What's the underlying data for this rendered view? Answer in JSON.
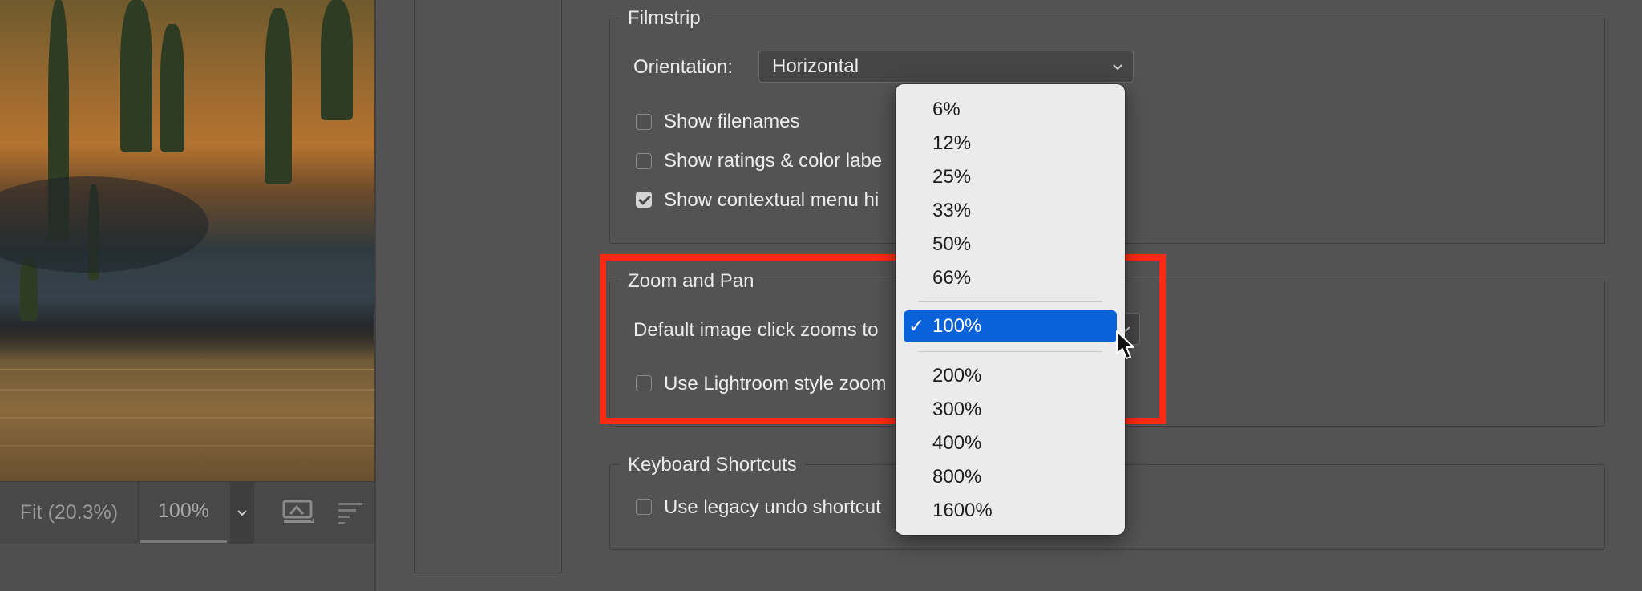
{
  "photo": {
    "description_name": "landscape-preview"
  },
  "zoombar": {
    "fit_label": "Fit (20.3%)",
    "zoom_value": "100%"
  },
  "filmstrip": {
    "title": "Filmstrip",
    "orientation_label": "Orientation:",
    "orientation_value": "Horizontal",
    "show_filenames": {
      "label": "Show filenames",
      "checked": false
    },
    "show_ratings": {
      "label": "Show ratings & color labe",
      "checked": false
    },
    "show_contextual": {
      "label": "Show contextual menu hi",
      "checked": true
    }
  },
  "zoom_pan": {
    "title": "Zoom and Pan",
    "default_click_label": "Default image click zooms to",
    "lightroom_style": {
      "label": "Use Lightroom style zoom",
      "checked": false
    }
  },
  "keyboard": {
    "title": "Keyboard Shortcuts",
    "legacy_undo": {
      "label": "Use legacy undo shortcut",
      "checked": false
    }
  },
  "zoom_menu": {
    "items": [
      "6%",
      "12%",
      "25%",
      "33%",
      "50%",
      "66%",
      "100%",
      "200%",
      "300%",
      "400%",
      "800%",
      "1600%"
    ],
    "selected": "100%",
    "check_glyph": "✓"
  },
  "colors": {
    "highlight": "#ff2a12",
    "menu_selection": "#0a62d8",
    "background": "#535353"
  }
}
